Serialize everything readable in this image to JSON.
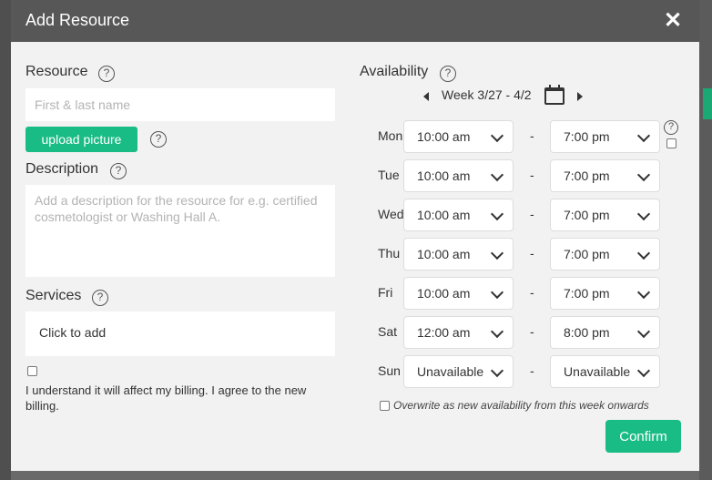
{
  "modal": {
    "title": "Add Resource",
    "close_glyph": "✕"
  },
  "resource": {
    "label": "Resource",
    "placeholder": "First & last name",
    "upload_label": "upload picture"
  },
  "description": {
    "label": "Description",
    "placeholder": "Add a description for the resource for e.g. certified cosmetologist or Washing Hall A."
  },
  "services": {
    "label": "Services",
    "value": "Click to add"
  },
  "billing": {
    "text": "I understand it will affect my billing. I agree to the new billing."
  },
  "availability": {
    "label": "Availability",
    "week": "Week 3/27 - 4/2",
    "separator": "-",
    "days": [
      {
        "day": "Mon",
        "start": "10:00 am",
        "end": "7:00 pm"
      },
      {
        "day": "Tue",
        "start": "10:00 am",
        "end": "7:00 pm"
      },
      {
        "day": "Wed",
        "start": "10:00 am",
        "end": "7:00 pm"
      },
      {
        "day": "Thu",
        "start": "10:00 am",
        "end": "7:00 pm"
      },
      {
        "day": "Fri",
        "start": "10:00 am",
        "end": "7:00 pm"
      },
      {
        "day": "Sat",
        "start": "12:00 am",
        "end": "8:00 pm"
      },
      {
        "day": "Sun",
        "start": "Unavailable",
        "end": "Unavailable"
      }
    ],
    "overwrite_text": "Overwrite as new availability from this week onwards"
  },
  "help_glyph": "?",
  "confirm_label": "Confirm",
  "colors": {
    "accent": "#1abc86",
    "header": "#575757",
    "panel": "#f2f2f2"
  }
}
